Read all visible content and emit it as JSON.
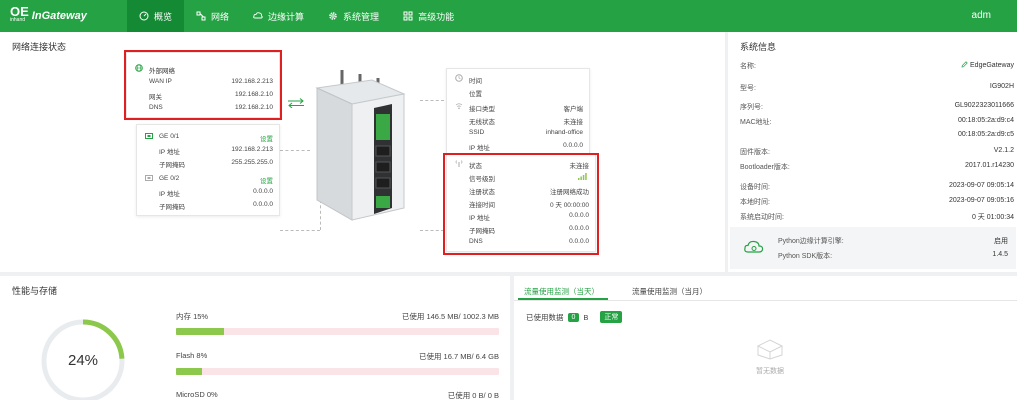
{
  "brand": {
    "logo_mark": "OE",
    "logo_sub": "inhand",
    "name": "InGateway"
  },
  "nav": [
    {
      "label": "概览",
      "icon": "dashboard-icon"
    },
    {
      "label": "网络",
      "icon": "network-icon"
    },
    {
      "label": "边缘计算",
      "icon": "cloud-icon"
    },
    {
      "label": "系统管理",
      "icon": "gear-icon"
    },
    {
      "label": "高级功能",
      "icon": "grid-icon"
    }
  ],
  "user": "adm",
  "network_status": {
    "title": "网络连接状态",
    "wan_card": {
      "title": "外部网络",
      "rows": [
        {
          "key": "WAN IP",
          "value": "192.168.2.213"
        },
        {
          "key": "网关",
          "value": "192.168.2.10"
        },
        {
          "key": "DNS",
          "value": "192.168.2.10"
        }
      ]
    },
    "ge_card": {
      "ge01": {
        "title": "GE 0/1",
        "status": "设置",
        "ip_label": "IP 地址",
        "ip": "192.168.2.213",
        "mask_label": "子网掩码",
        "mask": "255.255.255.0"
      },
      "ge02": {
        "title": "GE 0/2",
        "status": "设置",
        "ip_label": "IP 地址",
        "ip": "0.0.0.0",
        "mask_label": "子网掩码",
        "mask": "0.0.0.0"
      }
    },
    "right_card": {
      "time_label": "时间",
      "location_label": "位置",
      "iface_label": "接口类型",
      "iface_value": "客户端",
      "wifi_status_label": "无线状态",
      "wifi_status_value": "未连接",
      "ssid_label": "SSID",
      "ssid_value": "inhand-office",
      "ip_label": "IP 地址",
      "ip_value": "0.0.0.0"
    },
    "cell_card": {
      "rows": [
        {
          "key": "状态",
          "value": "未连接"
        },
        {
          "key": "信号级别",
          "value": ""
        },
        {
          "key": "注册状态",
          "value": "注册网络成功"
        },
        {
          "key": "连接时间",
          "value": "0 天 00:00:00"
        },
        {
          "key": "IP 地址",
          "value": "0.0.0.0"
        },
        {
          "key": "子网掩码",
          "value": "0.0.0.0"
        },
        {
          "key": "DNS",
          "value": "0.0.0.0"
        }
      ]
    }
  },
  "system_info": {
    "title": "系统信息",
    "rows": [
      {
        "key": "名称:",
        "value": "EdgeGateway"
      },
      {
        "key": "型号:",
        "value": "IG902H"
      },
      {
        "key": "序列号:",
        "value": "GL9022323011666"
      },
      {
        "key": "MAC地址:",
        "value": "00:18:05:2a:d9:c4"
      },
      {
        "key": "",
        "value": "00:18:05:2a:d9:c5"
      },
      {
        "key": "固件版本:",
        "value": "V2.1.2"
      },
      {
        "key": "Bootloader版本:",
        "value": "2017.01.r14230"
      },
      {
        "key": "设备时间:",
        "value": "2023-09-07 09:05:14"
      },
      {
        "key": "本地时间:",
        "value": "2023-09-07 09:05:16"
      },
      {
        "key": "系统启动时间:",
        "value": "0 天 01:00:34"
      }
    ],
    "python": [
      {
        "key": "Python边缘计算引擎:",
        "value": "启用"
      },
      {
        "key": "Python SDK版本:",
        "value": "1.4.5"
      }
    ]
  },
  "performance": {
    "title": "性能与存储",
    "gauge_value": 24,
    "gauge_label": "24%",
    "items": [
      {
        "label": "内存 15%",
        "used": "已使用 146.5 MB/ 1002.3 MB",
        "fraction": 0.15
      },
      {
        "label": "Flash 8%",
        "used": "已使用 16.7 MB/ 6.4 GB",
        "fraction": 0.08
      },
      {
        "label": "MicroSD 0%",
        "used": "已使用 0 B/ 0 B",
        "fraction": 0
      }
    ]
  },
  "traffic": {
    "tabs": [
      "流量使用监测（当天）",
      "流量使用监测（当月）"
    ],
    "used_label": "已使用数据",
    "used_value": "0",
    "used_unit": "B",
    "normal_badge": "正常",
    "empty": "暂无数据"
  },
  "colors": {
    "brand": "#25a244",
    "nav_active": "#158a34",
    "alert": "#e02020",
    "bar_fill": "#8cc84b",
    "bar_track": "#fbe4e8"
  }
}
